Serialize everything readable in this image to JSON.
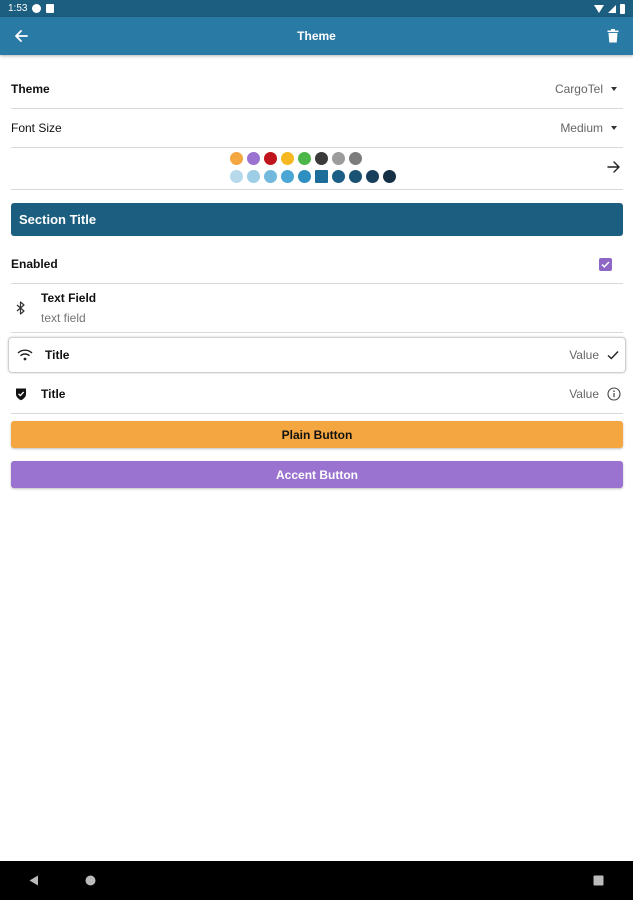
{
  "status_bar": {
    "time": "1:53"
  },
  "app_bar": {
    "title": "Theme",
    "back_icon": "arrow-left-icon",
    "delete_icon": "trash-icon"
  },
  "theme_row": {
    "label": "Theme",
    "value": "CargoTel"
  },
  "font_size_row": {
    "label": "Font Size",
    "value": "Medium"
  },
  "palette": {
    "row1": [
      "#f4a640",
      "#9a72d0",
      "#c0141c",
      "#f6b820",
      "#4cb648",
      "#3a3a3a",
      "#9c9c9c",
      "#7c7c7c"
    ],
    "row2": [
      "#b7d9ec",
      "#9ecde6",
      "#72b9dd",
      "#4aa6d3",
      "#2e8fc1",
      "#1d6d9a",
      "#1b5f86",
      "#1a5273",
      "#173f5c",
      "#152f45"
    ]
  },
  "section": {
    "title": "Section Title"
  },
  "enabled_row": {
    "label": "Enabled",
    "checked": true
  },
  "text_field": {
    "label": "Text Field",
    "placeholder": "text field",
    "icon": "bluetooth-icon"
  },
  "wifi_row": {
    "label": "Title",
    "value": "Value",
    "icon": "wifi-icon"
  },
  "shield_row": {
    "label": "Title",
    "value": "Value",
    "icon": "shield-icon"
  },
  "plain_button": {
    "label": "Plain Button",
    "color": "#f4a640"
  },
  "accent_button": {
    "label": "Accent Button",
    "color": "#9a72d0"
  },
  "colors": {
    "primary_dark": "#1c5e80",
    "primary": "#2a7aa6",
    "accent": "#8e66c6"
  }
}
